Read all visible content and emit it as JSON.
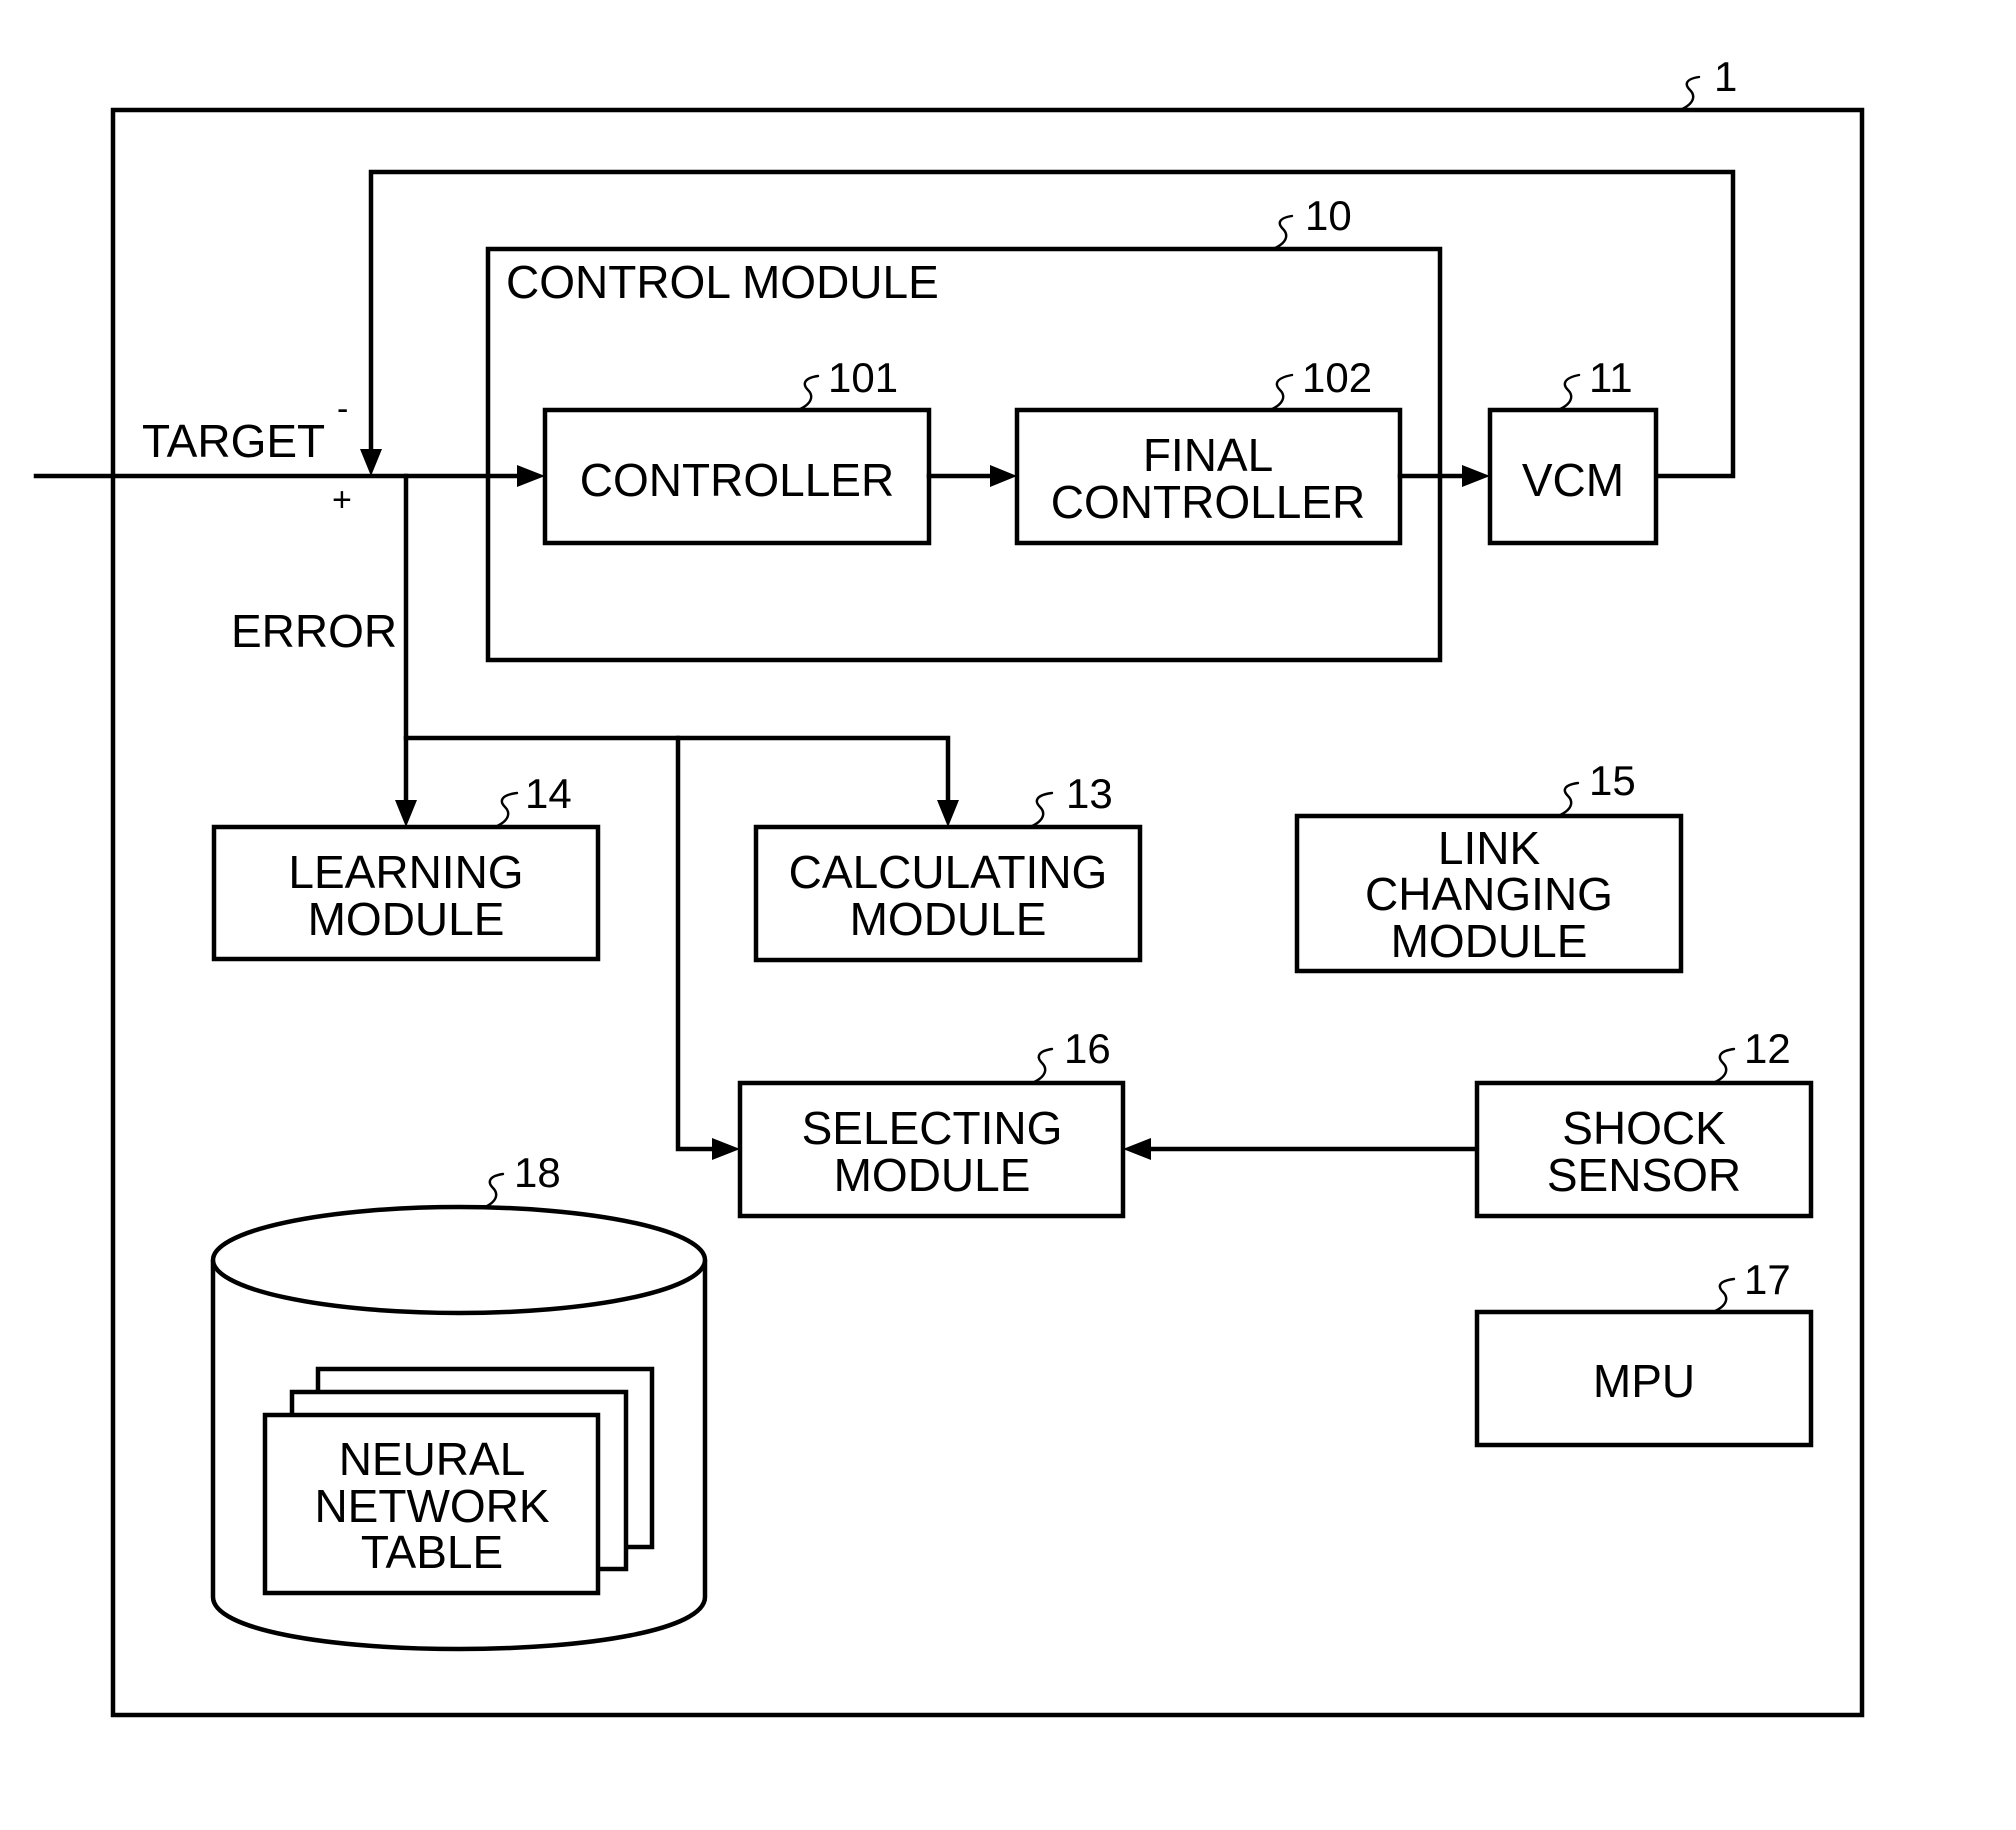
{
  "diagram": {
    "ref_device": "1",
    "signals": {
      "target": "TARGET",
      "minus": "-",
      "plus": "+",
      "error": "ERROR"
    },
    "control_module": {
      "ref": "10",
      "label": "CONTROL MODULE"
    },
    "controller": {
      "ref": "101",
      "label": "CONTROLLER"
    },
    "final_controller": {
      "ref": "102",
      "lines": [
        "FINAL",
        "CONTROLLER"
      ]
    },
    "vcm": {
      "ref": "11",
      "label": "VCM"
    },
    "learning_module": {
      "ref": "14",
      "lines": [
        "LEARNING",
        "MODULE"
      ]
    },
    "calculating_module": {
      "ref": "13",
      "lines": [
        "CALCULATING",
        "MODULE"
      ]
    },
    "link_changing_module": {
      "ref": "15",
      "lines": [
        "LINK",
        "CHANGING",
        "MODULE"
      ]
    },
    "selecting_module": {
      "ref": "16",
      "lines": [
        "SELECTING",
        "MODULE"
      ]
    },
    "shock_sensor": {
      "ref": "12",
      "lines": [
        "SHOCK",
        "SENSOR"
      ]
    },
    "mpu": {
      "ref": "17",
      "label": "MPU"
    },
    "storage": {
      "ref": "18",
      "table_lines": [
        "NEURAL",
        "NETWORK",
        "TABLE"
      ]
    },
    "connections": [
      {
        "from": "target-input",
        "to": "summing-junction"
      },
      {
        "from": "vcm",
        "to": "summing-junction",
        "sign": "-"
      },
      {
        "from": "summing-junction",
        "to": "controller"
      },
      {
        "from": "controller",
        "to": "final-controller"
      },
      {
        "from": "final-controller",
        "to": "vcm"
      },
      {
        "from": "error",
        "to": "learning-module"
      },
      {
        "from": "error",
        "to": "calculating-module"
      },
      {
        "from": "error",
        "to": "selecting-module"
      },
      {
        "from": "shock-sensor",
        "to": "selecting-module"
      }
    ]
  }
}
